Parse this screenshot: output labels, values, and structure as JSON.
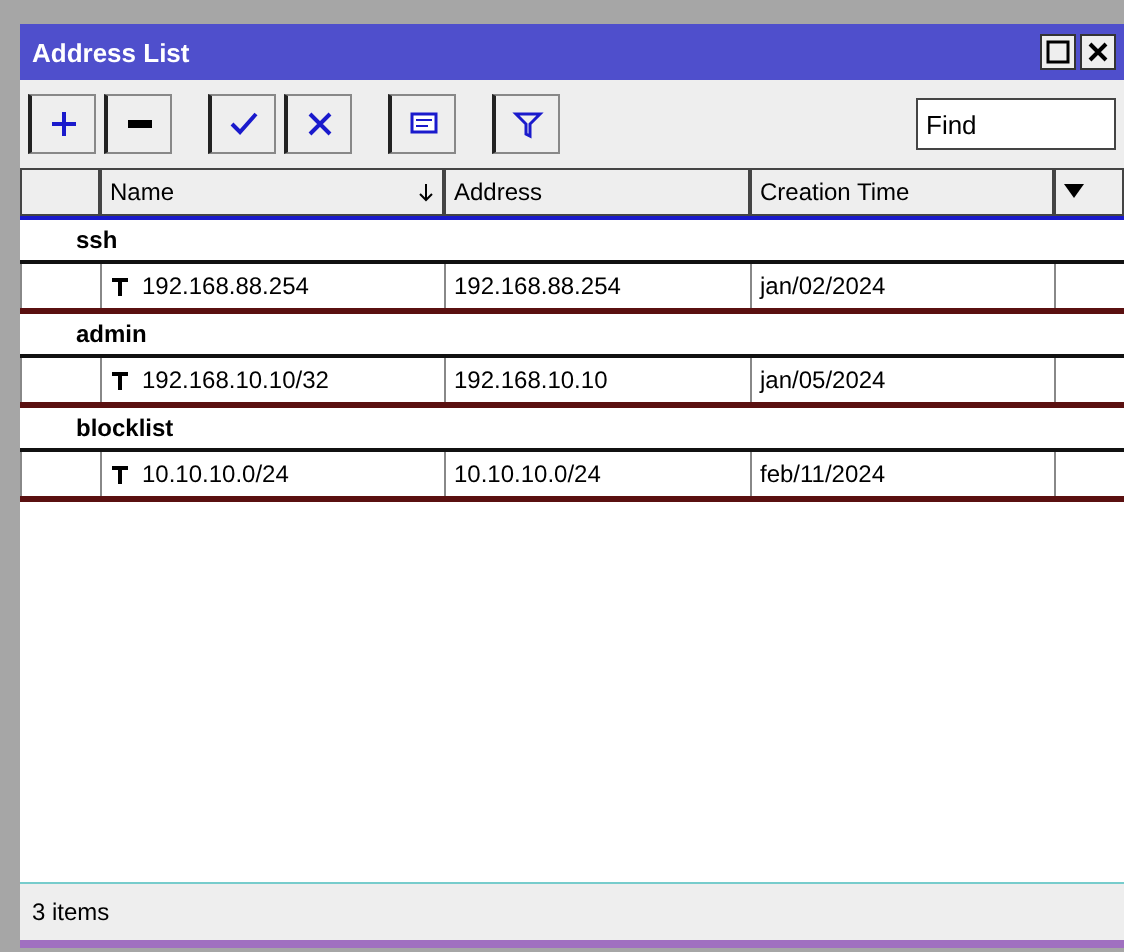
{
  "window": {
    "title": "Address List"
  },
  "toolbar": [
    {
      "kind": "add"
    },
    {
      "kind": "remove"
    },
    {
      "kind": "enable"
    },
    {
      "kind": "disable"
    },
    {
      "kind": "comment"
    },
    {
      "kind": "filter"
    }
  ],
  "search": {
    "value": "Find"
  },
  "table": {
    "columns": [
      "Name",
      "Address",
      "Creation Time"
    ],
    "groups": [
      {
        "name": "ssh",
        "rows": [
          {
            "cells": [
              "192.168.88.254",
              "192.168.88.254",
              "jan/02/2024"
            ]
          }
        ]
      },
      {
        "name": "admin",
        "rows": [
          {
            "cells": [
              "192.168.10.10/32",
              "192.168.10.10",
              "jan/05/2024"
            ]
          }
        ]
      },
      {
        "name": "blocklist",
        "rows": [
          {
            "cells": [
              "10.10.10.0/24",
              "10.10.10.0/24",
              "feb/11/2024"
            ]
          }
        ]
      }
    ]
  },
  "status_bar": {
    "text": "3 items"
  }
}
